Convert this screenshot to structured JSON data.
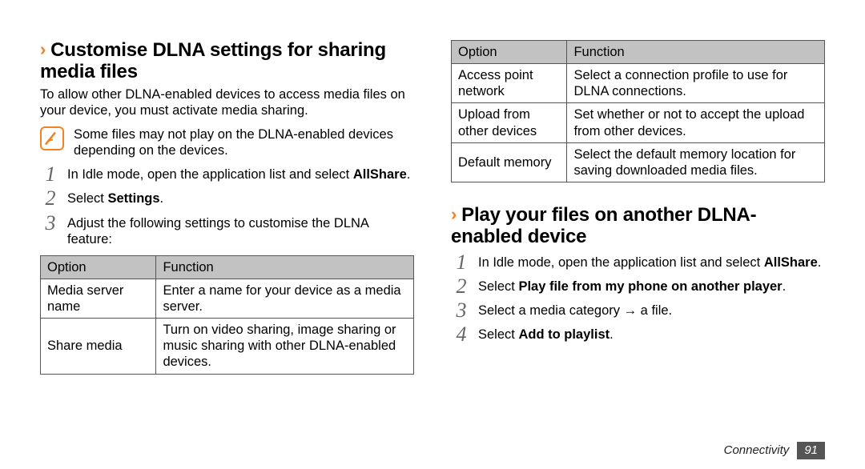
{
  "left": {
    "heading": "Customise DLNA settings for sharing media files",
    "lead": "To allow other DLNA-enabled devices to access media files on your device, you must activate media sharing.",
    "note": "Some files may not play on the DLNA-enabled devices depending on the devices.",
    "steps": {
      "s1a": "In Idle mode, open the application list and select ",
      "s1b": "AllShare",
      "s1c": ".",
      "s2a": "Select ",
      "s2b": "Settings",
      "s2c": ".",
      "s3": "Adjust the following settings to customise the DLNA feature:"
    },
    "table": {
      "h1": "Option",
      "h2": "Function",
      "rows": [
        {
          "opt": "Media server name",
          "fn": "Enter a name for your device as a media server."
        },
        {
          "opt": "Share media",
          "fn": "Turn on video sharing, image sharing or music sharing with other DLNA-enabled devices."
        }
      ]
    }
  },
  "right": {
    "table": {
      "h1": "Option",
      "h2": "Function",
      "rows": [
        {
          "opt": "Access point network",
          "fn": "Select a connection profile to use for DLNA connections."
        },
        {
          "opt": "Upload from other devices",
          "fn": "Set whether or not to accept the upload from other devices."
        },
        {
          "opt": "Default memory",
          "fn": "Select the default memory location for saving downloaded media files."
        }
      ]
    },
    "heading": "Play your files on another DLNA-enabled device",
    "steps": {
      "s1a": "In Idle mode, open the application list and select ",
      "s1b": "AllShare",
      "s1c": ".",
      "s2a": "Select ",
      "s2b": "Play file from my phone on another player",
      "s2c": ".",
      "s3": "Select a media category → a file.",
      "s4a": "Select ",
      "s4b": "Add to playlist",
      "s4c": "."
    }
  },
  "footer": {
    "section": "Connectivity",
    "page": "91"
  }
}
